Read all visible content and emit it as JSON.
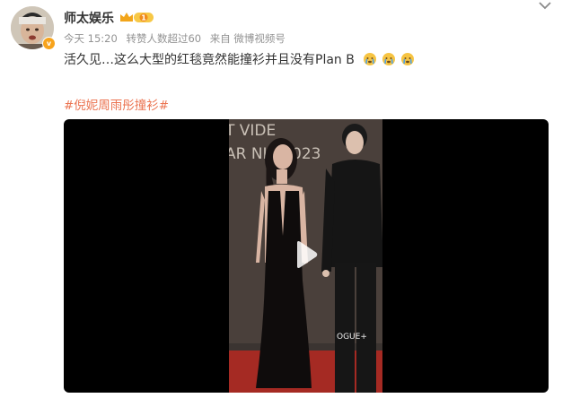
{
  "post": {
    "author": "师太娱乐",
    "vip_level": "1",
    "avatar_badge": "v",
    "time": "今天 15:20",
    "reposts": "转赞人数超过60",
    "source": "来自 微博视频号",
    "text": "活久见…这么大型的红毯竟然能撞衫并且没有Plan B",
    "emojis": [
      "crying-emoji",
      "crying-emoji",
      "crying-emoji"
    ],
    "hashtag": "#倪妮周雨彤撞衫#"
  },
  "video": {
    "backdrop_text": [
      "T VIDE",
      "AR NIG",
      "023"
    ],
    "sponsor_text": "OGUE+"
  },
  "colors": {
    "hashtag": "#eb7350",
    "meta": "#939393",
    "vip_gold": "#f7a31c",
    "carpet": "#a52a23"
  }
}
